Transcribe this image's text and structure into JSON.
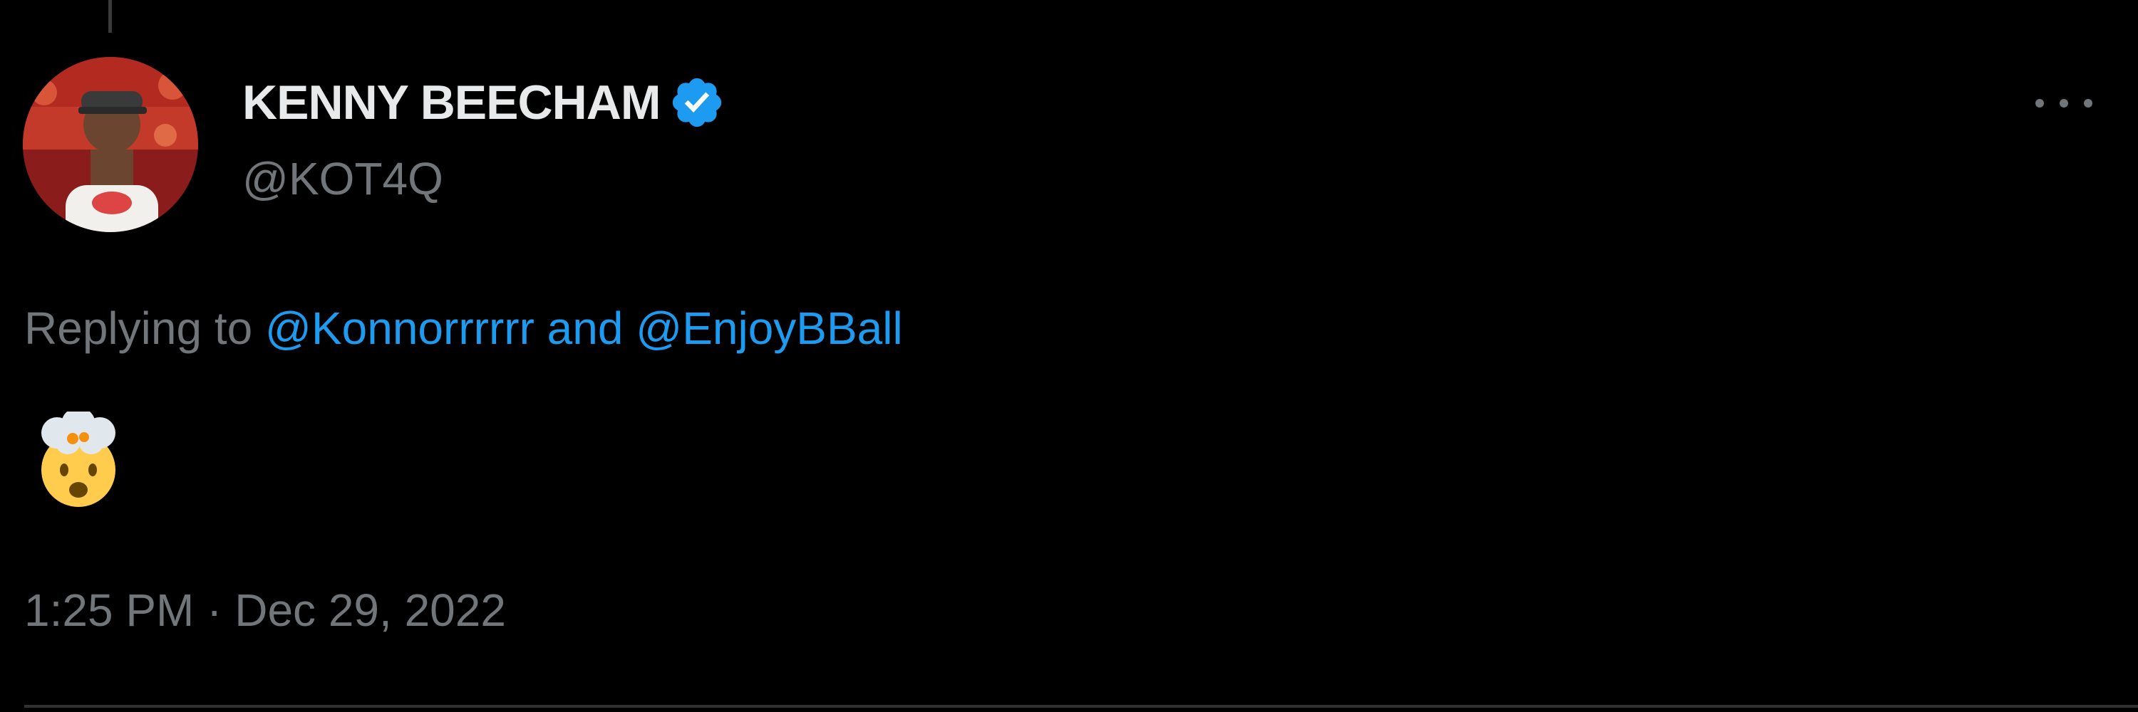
{
  "tweet": {
    "author": {
      "display_name": "KENNY BEECHAM",
      "handle": "@KOT4Q",
      "verified": true
    },
    "reply_context": {
      "prefix": "Replying to",
      "mention_1": "@Konnorrrrrr",
      "conjunction": "and",
      "mention_2": "@EnjoyBBall"
    },
    "body_emoji": "exploding-head-emoji",
    "timestamp": {
      "time": "1:25 PM",
      "separator": "·",
      "date": "Dec 29, 2022"
    }
  },
  "icons": {
    "verified": "verified-badge-icon",
    "more": "more-options-icon"
  },
  "colors": {
    "background": "#000000",
    "primary_text": "#e7e9ea",
    "secondary_text": "#71767b",
    "accent": "#1d9bf0",
    "divider": "#2f3336"
  }
}
